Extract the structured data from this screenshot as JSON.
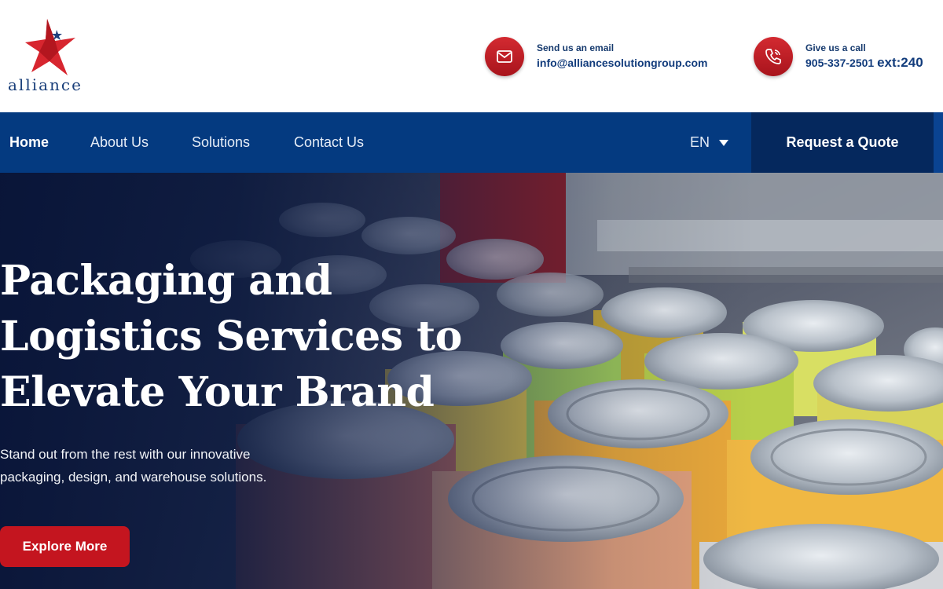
{
  "brand": {
    "logo_text": "alliance",
    "accent_red": "#c4151f",
    "nav_blue": "#043a80",
    "dark_blue": "#05285d"
  },
  "contact": {
    "email_label": "Send us an email",
    "email_value": "info@alliancesolutiongroup.com",
    "email_icon": "mail-icon",
    "phone_label": "Give us a call",
    "phone_value": "905-337-2501",
    "phone_ext": "ext:240",
    "phone_icon": "phone-icon"
  },
  "nav": {
    "items": [
      {
        "label": "Home",
        "active": true
      },
      {
        "label": "About Us"
      },
      {
        "label": "Solutions"
      },
      {
        "label": "Contact Us"
      }
    ],
    "language": "EN",
    "cta": "Request a Quote"
  },
  "hero": {
    "title_lines": [
      "Packaging and",
      "Logistics Services to",
      "Elevate Your Brand"
    ],
    "subtitle_lines": [
      "Stand out from the rest with our innovative",
      "packaging, design, and warehouse solutions."
    ],
    "button": "Explore More",
    "background_icon": "aluminum-cans-image"
  }
}
